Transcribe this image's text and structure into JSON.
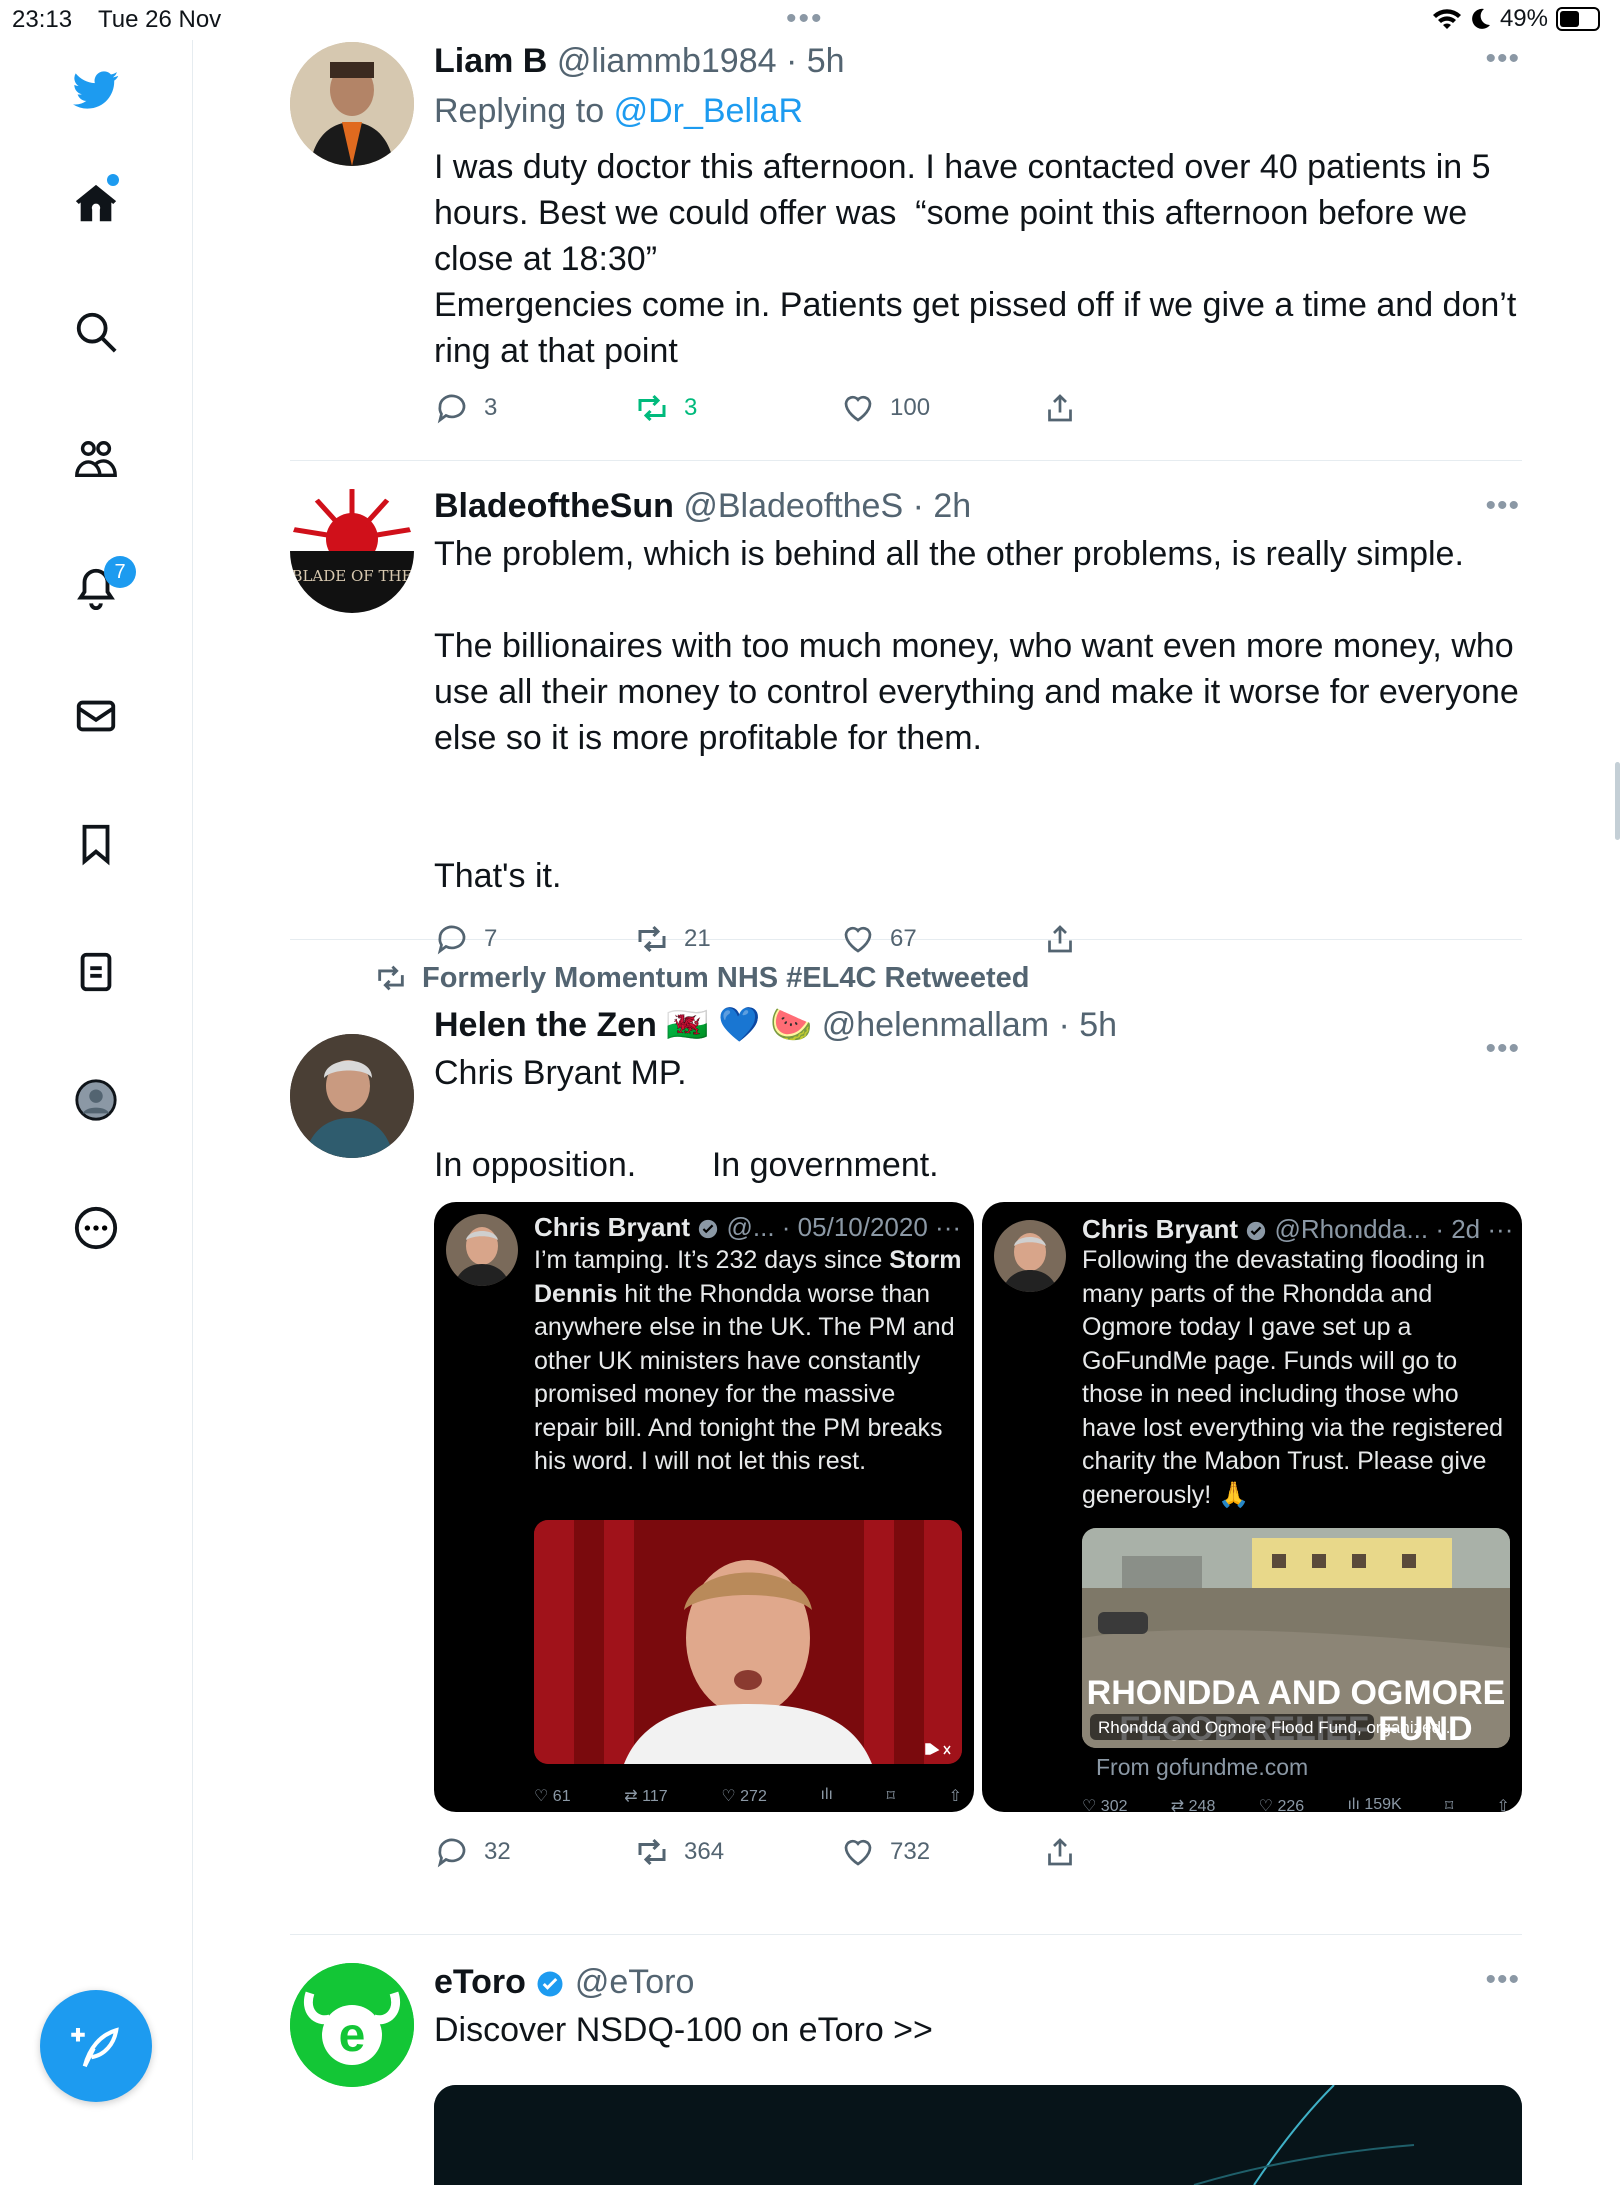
{
  "status_bar": {
    "time": "23:13",
    "date": "Tue 26 Nov",
    "battery": "49%",
    "battery_level": 0.49
  },
  "sidebar": {
    "items": [
      "Home",
      "Search",
      "Communities",
      "Notifications",
      "Messages",
      "Bookmarks",
      "Lists",
      "Profile",
      "More"
    ],
    "notification_count": "7"
  },
  "tweets": [
    {
      "name": "Liam B",
      "handle": "@liammb1984",
      "time": "· 5h",
      "replying_prefix": "Replying to",
      "replying_to": "@Dr_BellaR",
      "text": "I was duty doctor this afternoon. I have contacted over 40 patients in 5 hours. Best we could offer was  “some point this afternoon before we close at 18:30”\nEmergencies come in. Patients get pissed off if we give a time and don’t ring at that point",
      "replies": "3",
      "retweets": "3",
      "likes": "100"
    },
    {
      "name": "BladeoftheSun",
      "handle": "@BladeoftheS",
      "time": "· 2h",
      "avatar_text": "BLADE OF THE",
      "text": "The problem, which is behind all the other problems, is really simple.\n\nThe billionaires with too much money, who want even more money, who use all their money to control everything and make it worse for everyone else so it is more profitable for them.\n\n\nThat's it.",
      "replies": "7",
      "retweets": "21",
      "likes": "67"
    },
    {
      "retweeted_by": "Formerly Momentum NHS #EL4C Retweeted",
      "name": "Helen the Zen",
      "emojis": "🏴󠁧󠁢󠁷󠁬󠁳󠁿 💙 🍉",
      "handle": "@helenmallam",
      "time": "· 5h",
      "text": "Chris Bryant MP.\n\nIn opposition.        In government.",
      "replies": "32",
      "retweets": "364",
      "likes": "732",
      "media": [
        {
          "name": "Chris Bryant",
          "meta": "@... · 05/10/2020",
          "text_before": "I’m tamping. It’s 232 days since ",
          "text_bold": "Storm Dennis",
          "text_after": " hit the Rhondda worse than anywhere else in the UK. The PM and other UK ministers have constantly promised money for the massive repair bill. And tonight the PM breaks his word. I will not let this rest.",
          "stats": [
            "61",
            "117",
            "272",
            "",
            "",
            ""
          ]
        },
        {
          "name": "Chris Bryant",
          "meta": "@Rhondda... · 2d",
          "text": "Following the devastating flooding in many parts of the Rhondda and Ogmore today I gave set up a GoFundMe page. Funds will go to those in need including those who have lost everything via the registered charity the Mabon Trust. Please give generously! 🙏",
          "overlay_title": "RHONDDA AND OGMORE",
          "overlay_sub": "FLOOD RELIEF FUND",
          "caption": "Rhondda and Ogmore Flood Fund, organized...",
          "source": "From gofundme.com",
          "stats": [
            "302",
            "248",
            "226",
            "159K",
            ""
          ]
        }
      ]
    },
    {
      "name": "eToro",
      "handle": "@eToro",
      "text": "Discover NSDQ-100 on eToro >>"
    }
  ]
}
